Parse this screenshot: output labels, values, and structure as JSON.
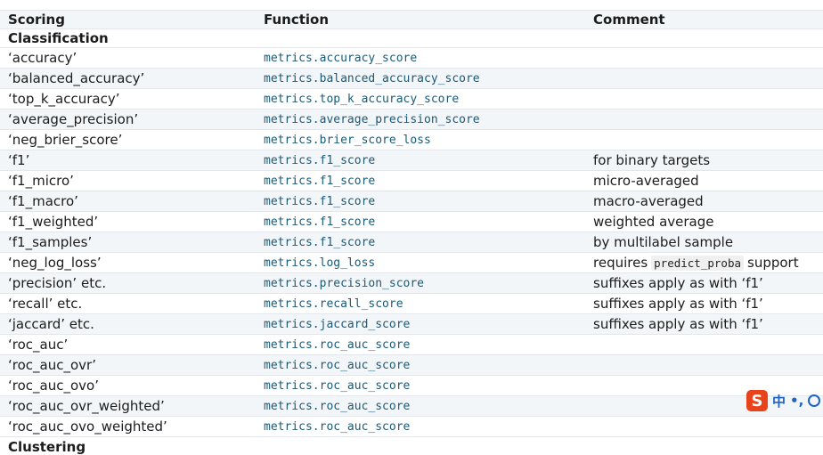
{
  "header": {
    "col1": "Scoring",
    "col2": "Function",
    "col3": "Comment"
  },
  "sections": {
    "classification": "Classification",
    "clustering": "Clustering"
  },
  "rows": [
    {
      "scoring": "‘accuracy’",
      "function": "metrics.accuracy_score",
      "comment": ""
    },
    {
      "scoring": "‘balanced_accuracy’",
      "function": "metrics.balanced_accuracy_score",
      "comment": ""
    },
    {
      "scoring": "‘top_k_accuracy’",
      "function": "metrics.top_k_accuracy_score",
      "comment": ""
    },
    {
      "scoring": "‘average_precision’",
      "function": "metrics.average_precision_score",
      "comment": ""
    },
    {
      "scoring": "‘neg_brier_score’",
      "function": "metrics.brier_score_loss",
      "comment": ""
    },
    {
      "scoring": "‘f1’",
      "function": "metrics.f1_score",
      "comment": "for binary targets"
    },
    {
      "scoring": "‘f1_micro’",
      "function": "metrics.f1_score",
      "comment": "micro-averaged"
    },
    {
      "scoring": "‘f1_macro’",
      "function": "metrics.f1_score",
      "comment": "macro-averaged"
    },
    {
      "scoring": "‘f1_weighted’",
      "function": "metrics.f1_score",
      "comment": "weighted average"
    },
    {
      "scoring": "‘f1_samples’",
      "function": "metrics.f1_score",
      "comment": "by multilabel sample"
    },
    {
      "scoring": "‘neg_log_loss’",
      "function": "metrics.log_loss",
      "comment_prefix": "requires",
      "comment_code": "predict_proba",
      "comment_suffix": "support"
    },
    {
      "scoring": "‘precision’ etc.",
      "function": "metrics.precision_score",
      "comment": "suffixes apply as with ‘f1’"
    },
    {
      "scoring": "‘recall’ etc.",
      "function": "metrics.recall_score",
      "comment": "suffixes apply as with ‘f1’"
    },
    {
      "scoring": "‘jaccard’ etc.",
      "function": "metrics.jaccard_score",
      "comment": "suffixes apply as with ‘f1’"
    },
    {
      "scoring": "‘roc_auc’",
      "function": "metrics.roc_auc_score",
      "comment": ""
    },
    {
      "scoring": "‘roc_auc_ovr’",
      "function": "metrics.roc_auc_score",
      "comment": ""
    },
    {
      "scoring": "‘roc_auc_ovo’",
      "function": "metrics.roc_auc_score",
      "comment": ""
    },
    {
      "scoring": "‘roc_auc_ovr_weighted’",
      "function": "metrics.roc_auc_score",
      "comment": ""
    },
    {
      "scoring": "‘roc_auc_ovo_weighted’",
      "function": "metrics.roc_auc_score",
      "comment": ""
    }
  ],
  "ime": {
    "logo": "S",
    "lang": "中",
    "punct": "•,"
  },
  "colors": {
    "function_link": "#1a5a77",
    "row_stripe": "#f2f6f9",
    "ime_logo": "#e8431a",
    "ime_blue": "#1e63c5"
  },
  "icons": {
    "ime_logo": "sogou-ime-icon",
    "ime_emoji": "smiley-icon"
  }
}
